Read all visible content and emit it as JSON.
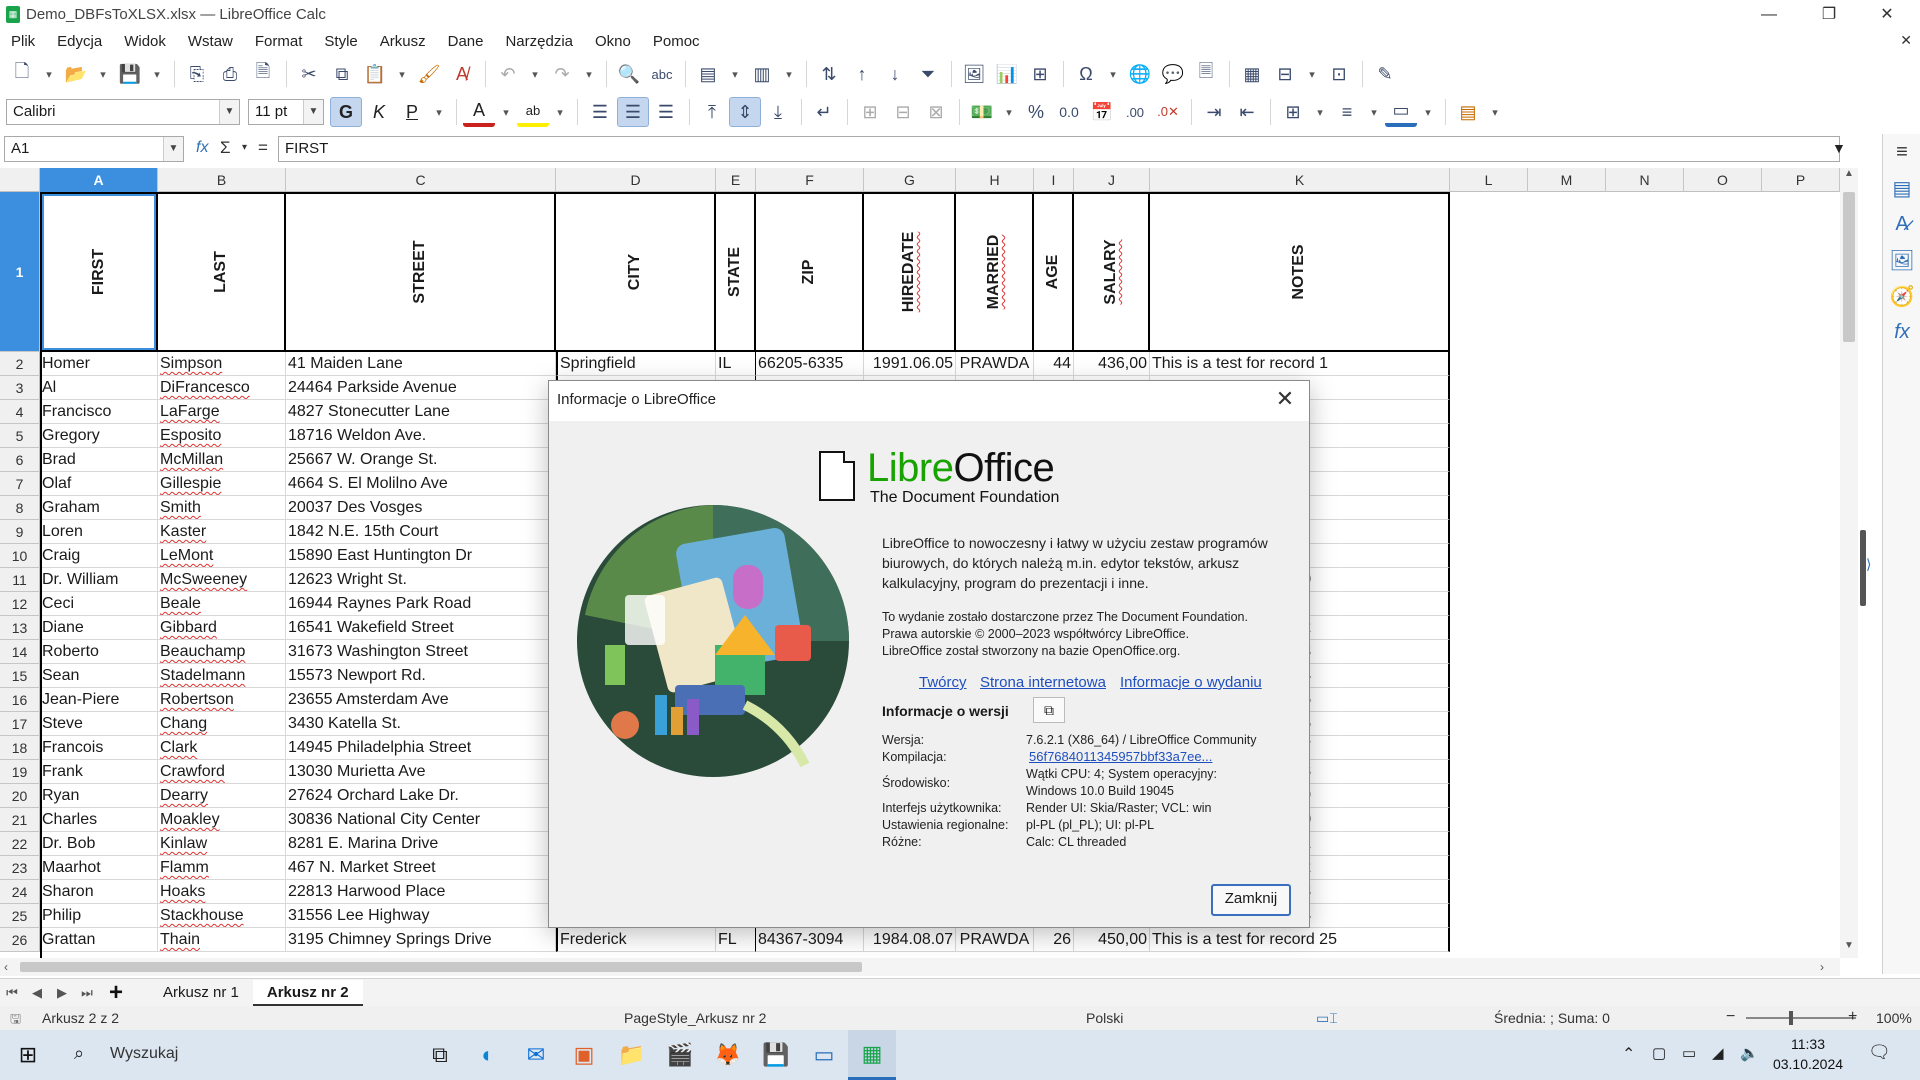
{
  "window": {
    "title": "Demo_DBFsToXLSX.xlsx — LibreOffice Calc"
  },
  "menu": [
    "Plik",
    "Edycja",
    "Widok",
    "Wstaw",
    "Format",
    "Style",
    "Arkusz",
    "Dane",
    "Narzędzia",
    "Okno",
    "Pomoc"
  ],
  "formatting": {
    "font_name": "Calibri",
    "font_size": "11 pt",
    "bold": "G",
    "italic": "K",
    "underline": "P",
    "font_color_label": "A",
    "highlight_label": "ab"
  },
  "formula_bar": {
    "cell_ref": "A1",
    "fx": "fx",
    "sum": "Σ",
    "eq": "=",
    "content": "FIRST"
  },
  "columns": [
    "A",
    "B",
    "C",
    "D",
    "E",
    "F",
    "G",
    "H",
    "I",
    "J",
    "K",
    "L",
    "M",
    "N",
    "O",
    "P"
  ],
  "header_row": {
    "row": "1",
    "labels": [
      "FIRST",
      "LAST",
      "STREET",
      "CITY",
      "STATE",
      "ZIP",
      "HIREDATE",
      "MARRIED",
      "AGE",
      "SALARY",
      "NOTES"
    ]
  },
  "rows": [
    {
      "n": "2",
      "first": "Homer",
      "last": "Simpson",
      "street": "41 Maiden Lane",
      "city": "Springfield",
      "state": "IL",
      "zip": "66205-6335",
      "hire": "1991.06.05",
      "married": "PRAWDA",
      "age": "44",
      "salary": "436,00",
      "notes": "This is a test for record 1"
    },
    {
      "n": "3",
      "first": "Al",
      "last": "DiFrancesco",
      "street": "24464 Parkside Avenue",
      "notes_tail": "d 2"
    },
    {
      "n": "4",
      "first": "Francisco",
      "last": "LaFarge",
      "street": "4827 Stonecutter Lane",
      "notes_tail": "d 3"
    },
    {
      "n": "5",
      "first": "Gregory",
      "last": "Esposito",
      "street": "18716 Weldon Ave.",
      "notes_tail": "d 4"
    },
    {
      "n": "6",
      "first": "Brad",
      "last": "McMillan",
      "street": "25667 W. Orange St.",
      "notes_tail": "d 5"
    },
    {
      "n": "7",
      "first": "Olaf",
      "last": "Gillespie",
      "street": "4664 S. El Molilno Ave",
      "notes_tail": "d 6"
    },
    {
      "n": "8",
      "first": "Graham",
      "last": "Smith",
      "street": "20037 Des Vosges",
      "notes_tail": "d 7"
    },
    {
      "n": "9",
      "first": "Loren",
      "last": "Kaster",
      "street": "1842 N.E. 15th Court",
      "notes_tail": "d 8"
    },
    {
      "n": "10",
      "first": "Craig",
      "last": "LeMont",
      "street": "15890 East Huntington Dr",
      "notes_tail": "d 9"
    },
    {
      "n": "11",
      "first": "Dr. William",
      "last": "McSweeney",
      "street": "12623 Wright St.",
      "notes_tail": "d 10"
    },
    {
      "n": "12",
      "first": "Ceci",
      "last": "Beale",
      "street": "16944 Raynes Park Road",
      "notes_tail": "d 11"
    },
    {
      "n": "13",
      "first": "Diane",
      "last": "Gibbard",
      "street": "16541 Wakefield Street",
      "notes_tail": "d 12"
    },
    {
      "n": "14",
      "first": "Roberto",
      "last": "Beauchamp",
      "street": "31673 Washington Street",
      "notes_tail": "d 13"
    },
    {
      "n": "15",
      "first": "Sean",
      "last": "Stadelmann",
      "street": "15573 Newport Rd.",
      "notes_tail": "d 14"
    },
    {
      "n": "16",
      "first": "Jean-Piere",
      "last": "Robertson",
      "street": "23655 Amsterdam Ave",
      "notes_tail": "d 15"
    },
    {
      "n": "17",
      "first": "Steve",
      "last": "Chang",
      "street": "3430 Katella St.",
      "notes_tail": "d 16"
    },
    {
      "n": "18",
      "first": "Francois",
      "last": "Clark",
      "street": "14945 Philadelphia Street",
      "notes_tail": "d 17"
    },
    {
      "n": "19",
      "first": "Frank",
      "last": "Crawford",
      "street": "13030 Murietta Ave",
      "notes_tail": "d 18"
    },
    {
      "n": "20",
      "first": "Ryan",
      "last": "Dearry",
      "street": "27624 Orchard Lake Dr.",
      "notes_tail": "d 19"
    },
    {
      "n": "21",
      "first": "Charles",
      "last": "Moakley",
      "street": "30836 National City Center",
      "notes_tail": "d 20"
    },
    {
      "n": "22",
      "first": "Dr. Bob",
      "last": "Kinlaw",
      "street": "8281 E. Marina Drive",
      "notes_tail": "d 21"
    },
    {
      "n": "23",
      "first": "Maarhot",
      "last": "Flamm",
      "street": "467 N. Market Street",
      "notes_tail": "d 22"
    },
    {
      "n": "24",
      "first": "Sharon",
      "last": "Hoaks",
      "street": "22813 Harwood Place",
      "notes_tail": "d 23"
    },
    {
      "n": "25",
      "first": "Philip",
      "last": "Stackhouse",
      "street": "31556 Lee Highway",
      "notes_tail": "d 24"
    },
    {
      "n": "26",
      "first": "Grattan",
      "last": "Thain",
      "street": "3195 Chimney Springs Drive",
      "city": "Frederick",
      "state": "FL",
      "zip": "84367-3094",
      "hire": "1984.08.07",
      "married": "PRAWDA",
      "age": "26",
      "salary": "450,00",
      "notes": "This is a test for record 25"
    }
  ],
  "sheets": {
    "tabs": [
      "Arkusz nr 1",
      "Arkusz nr 2"
    ],
    "active": "Arkusz nr 2"
  },
  "status": {
    "sheet": "Arkusz 2 z 2",
    "page_style": "PageStyle_Arkusz nr 2",
    "language": "Polski",
    "summary": "Średnia: ; Suma: 0",
    "zoom": "100%"
  },
  "dialog": {
    "title": "Informacje o LibreOffice",
    "logo_text_a": "Libre",
    "logo_text_b": "Office",
    "logo_subtitle": "The Document Foundation",
    "description": "LibreOffice to nowoczesny i łatwy w użyciu zestaw programów biurowych, do których należą m.in. edytor tekstów, arkusz kalkulacyjny, program do prezentacji i inne.",
    "release_line1": "To wydanie zostało dostarczone przez The Document Foundation.",
    "release_line2": "Prawa autorskie © 2000–2023 współtwórcy LibreOffice.",
    "release_line3": "LibreOffice został stworzony na bazie OpenOffice.org.",
    "links": [
      "Twórcy",
      "Strona internetowa",
      "Informacje o wydaniu"
    ],
    "version_heading": "Informacje o wersji",
    "info": [
      {
        "label": "Wersja:",
        "value": "7.6.2.1 (X86_64) / LibreOffice Community"
      },
      {
        "label": "Kompilacja:",
        "value": "56f7684011345957bbf33a7ee..."
      },
      {
        "label": "Środowisko:",
        "value": "Wątki CPU: 4; System operacyjny:",
        "value2": "Windows 10.0 Build 19045"
      },
      {
        "label": "Interfejs użytkownika:",
        "value": "Render UI: Skia/Raster; VCL: win"
      },
      {
        "label": "Ustawienia regionalne:",
        "value": "pl-PL (pl_PL); UI: pl-PL"
      },
      {
        "label": "Różne:",
        "value": "Calc: CL threaded"
      }
    ],
    "close_button": "Zamknij"
  },
  "taskbar": {
    "search_placeholder": "Wyszukaj",
    "time": "11:33",
    "date": "03.10.2024"
  },
  "colors": {
    "selection": "#3c8fde",
    "lo_green": "#18a303",
    "link": "#1f4fbf",
    "taskbar": "#dce6f1"
  }
}
